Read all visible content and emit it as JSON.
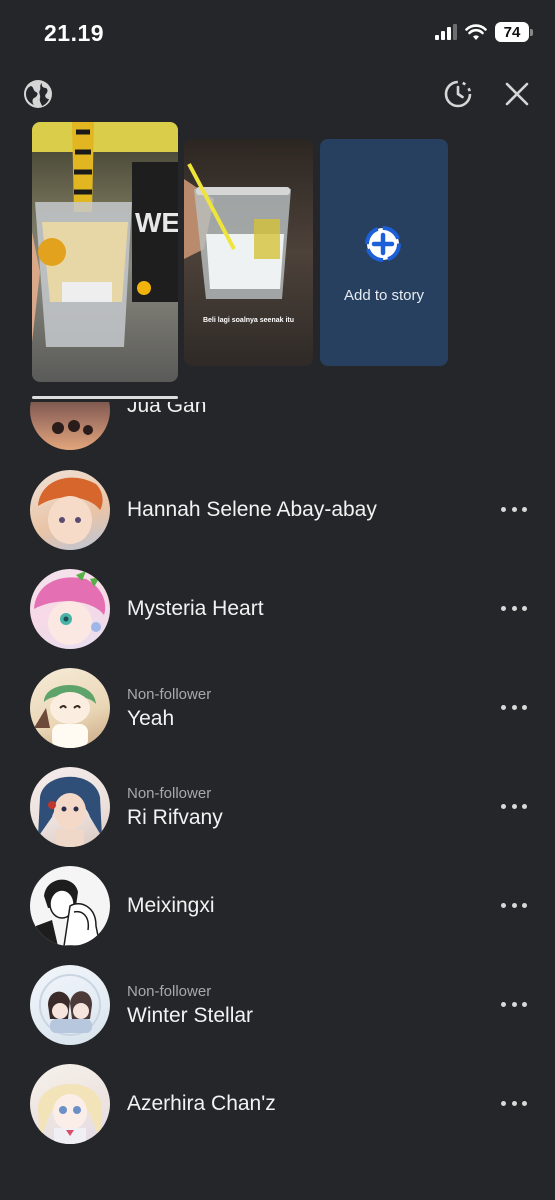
{
  "status": {
    "time": "21.19",
    "battery": "74"
  },
  "topbar": {
    "globe_icon": "globe-icon",
    "history_icon": "clock-history-icon",
    "close_icon": "close-icon"
  },
  "stories": {
    "story2_caption": "Beli lagi soalnya seenak itu",
    "add_label": "Add to story"
  },
  "viewers": [
    {
      "name": "Jua Gan",
      "subtitle": ""
    },
    {
      "name": "Hannah Selene Abay-abay",
      "subtitle": ""
    },
    {
      "name": "Mysteria Heart",
      "subtitle": ""
    },
    {
      "name": "Yeah",
      "subtitle": "Non-follower"
    },
    {
      "name": "Ri Rifvany",
      "subtitle": "Non-follower"
    },
    {
      "name": "Meixingxi",
      "subtitle": ""
    },
    {
      "name": "Winter Stellar",
      "subtitle": "Non-follower"
    },
    {
      "name": "Azerhira Chan'z",
      "subtitle": ""
    }
  ]
}
